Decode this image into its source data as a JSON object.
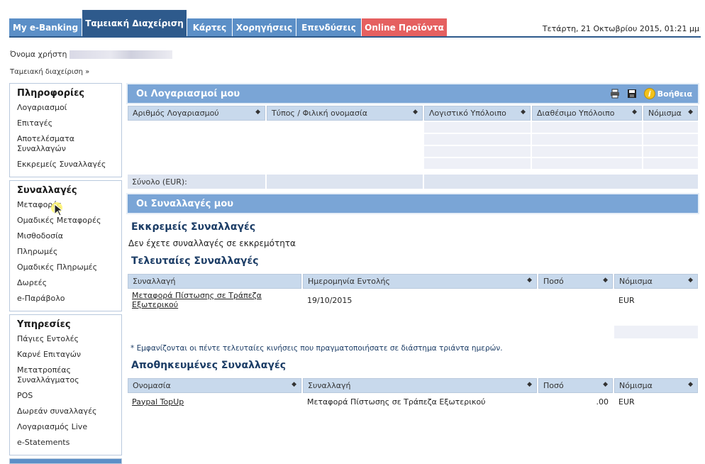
{
  "nav": {
    "tabs": [
      {
        "label": "My e-Banking"
      },
      {
        "label": "Ταμειακή Διαχείριση"
      },
      {
        "label": "Κάρτες"
      },
      {
        "label": "Χορηγήσεις"
      },
      {
        "label": "Επενδύσεις"
      },
      {
        "label": "Online Προϊόντα"
      }
    ],
    "datetime": "Τετάρτη, 21 Οκτωβρίου 2015, 01:21 μμ"
  },
  "user": {
    "label": "Όνομα χρήστη"
  },
  "breadcrumb": "Ταμειακή διαχείριση »",
  "sidebar": {
    "groups": [
      {
        "title": "Πληροφορίες",
        "items": [
          "Λογαριασμοί",
          "Επιταγές",
          "Αποτελέσματα Συναλλαγών",
          "Εκκρεμείς Συναλλαγές"
        ]
      },
      {
        "title": "Συναλλαγές",
        "items": [
          "Μεταφορές",
          "Ομαδικές Μεταφορές",
          "Μισθοδοσία",
          "Πληρωμές",
          "Ομαδικές Πληρωμές",
          "Δωρεές",
          "e-Παράβολο"
        ]
      },
      {
        "title": "Υπηρεσίες",
        "items": [
          "Πάγιες Εντολές",
          "Καρνέ Επιταγών",
          "Μετατροπέας Συναλλάγματος",
          "POS",
          "Δωρεάν συναλλαγές",
          "Λογαριασμός Live",
          "e-Statements"
        ]
      }
    ]
  },
  "accounts": {
    "title": "Οι Λογαριασμοί μου",
    "help_label": "Βοήθεια",
    "columns": [
      "Αριθμός Λογαριασμού",
      "Τύπος / Φιλική ονομασία",
      "Λογιστικό Υπόλοιπο",
      "Διαθέσιμο Υπόλοιπο",
      "Νόμισμα"
    ],
    "total_label": "Σύνολο (EUR):"
  },
  "transactions": {
    "title": "Οι Συναλλαγές μου",
    "pending_heading": "Εκκρεμείς Συναλλαγές",
    "pending_empty": "Δεν έχετε συναλλαγές σε εκκρεμότητα",
    "recent_heading": "Τελευταίες Συναλλαγές",
    "recent_columns": [
      "Συναλλαγή",
      "Ημερομηνία Εντολής",
      "Ποσό",
      "Νόμισμα"
    ],
    "recent_rows": [
      {
        "type": "Μεταφορά Πίστωσης σε Τράπεζα Εξωτερικού",
        "date": "19/10/2015",
        "currency": "EUR"
      }
    ],
    "note": "* Εμφανίζονται οι πέντε τελευταίες κινήσεις που πραγματοποιήσατε σε διάστημα τριάντα ημερών.",
    "saved_heading": "Αποθηκευμένες Συναλλαγές",
    "saved_columns": [
      "Ονομασία",
      "Συναλλαγή",
      "Ποσό",
      "Νόμισμα"
    ],
    "saved_rows": [
      {
        "name": "Paypal TopUp",
        "type": "Μεταφορά Πίστωσης σε Τράπεζα Εξωτερικού",
        "amount_suffix": ".00",
        "currency": "EUR"
      }
    ]
  },
  "colors": {
    "tab_blue": "#5b8fc7",
    "tab_active": "#2e5a8c",
    "tab_red": "#e56060",
    "panel_head": "#7aa5d6",
    "header_cell": "#c8d9ec"
  }
}
